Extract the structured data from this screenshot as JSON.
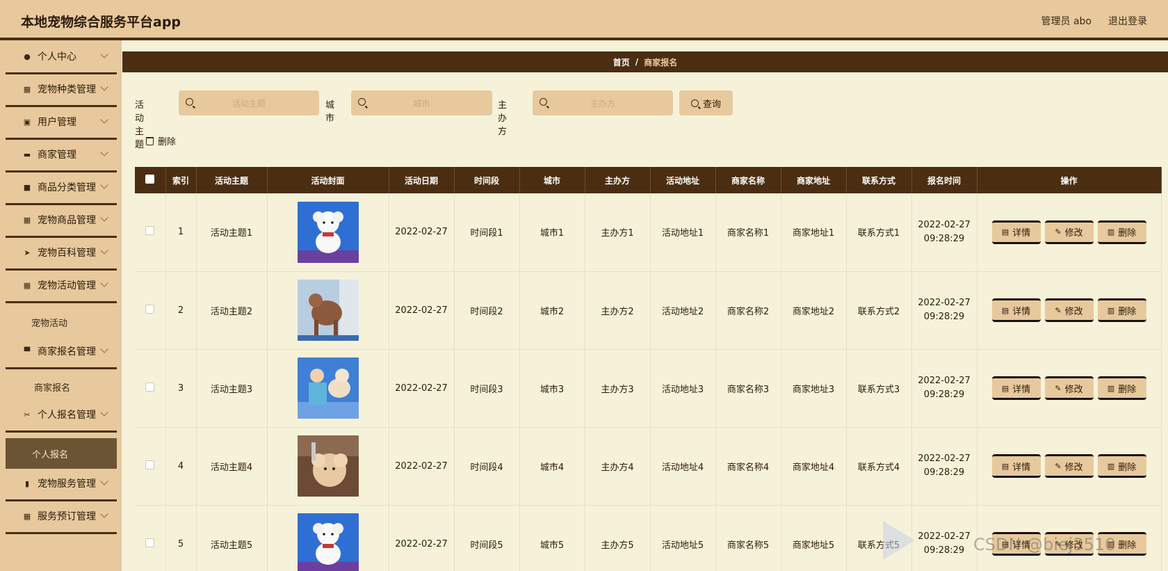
{
  "header": {
    "title": "本地宠物综合服务平台app",
    "user": "管理员 abo",
    "logout": "退出登录"
  },
  "sidebar": {
    "items": [
      {
        "label": "个人中心",
        "icon": "person-icon"
      },
      {
        "label": "宠物种类管理",
        "icon": "grid-icon"
      },
      {
        "label": "用户管理",
        "icon": "clipboard-icon"
      },
      {
        "label": "商家管理",
        "icon": "chat-icon"
      },
      {
        "label": "商品分类管理",
        "icon": "briefcase-icon"
      },
      {
        "label": "宠物商品管理",
        "icon": "grid-icon"
      },
      {
        "label": "宠物百科管理",
        "icon": "send-icon"
      },
      {
        "label": "宠物活动管理",
        "icon": "grid-icon"
      },
      {
        "label": "商家报名管理",
        "icon": "printer-icon"
      },
      {
        "label": "个人报名管理",
        "icon": "ticket-icon"
      },
      {
        "label": "宠物服务管理",
        "icon": "bars-icon"
      },
      {
        "label": "服务预订管理",
        "icon": "grid-icon"
      }
    ],
    "subs": {
      "pet_activity": "宠物活动",
      "merchant_signup": "商家报名",
      "personal_signup": "个人报名"
    }
  },
  "breadcrumb": {
    "home": "首页",
    "sep": "/",
    "current": "商家报名"
  },
  "search": {
    "topic_label": "活动主题",
    "topic_placeholder": "活动主题",
    "city_label": "城市",
    "city_placeholder": "城市",
    "organizer_label": "主办方",
    "organizer_placeholder": "主办方",
    "button": "查询"
  },
  "toolbar": {
    "delete": "删除"
  },
  "table": {
    "headers": [
      "索引",
      "活动主题",
      "活动封面",
      "活动日期",
      "时间段",
      "城市",
      "主办方",
      "活动地址",
      "商家名称",
      "商家地址",
      "联系方式",
      "报名时间",
      "操作"
    ],
    "rows": [
      {
        "index": "1",
        "topic": "活动主题1",
        "date": "2022-02-27",
        "slot": "时间段1",
        "city": "城市1",
        "organizer": "主办方1",
        "address": "活动地址1",
        "merchant": "商家名称1",
        "maddr": "商家地址1",
        "contact": "联系方式1",
        "time_date": "2022-02-27",
        "time_clock": "09:28:29"
      },
      {
        "index": "2",
        "topic": "活动主题2",
        "date": "2022-02-27",
        "slot": "时间段2",
        "city": "城市2",
        "organizer": "主办方2",
        "address": "活动地址2",
        "merchant": "商家名称2",
        "maddr": "商家地址2",
        "contact": "联系方式2",
        "time_date": "2022-02-27",
        "time_clock": "09:28:29"
      },
      {
        "index": "3",
        "topic": "活动主题3",
        "date": "2022-02-27",
        "slot": "时间段3",
        "city": "城市3",
        "organizer": "主办方3",
        "address": "活动地址3",
        "merchant": "商家名称3",
        "maddr": "商家地址3",
        "contact": "联系方式3",
        "time_date": "2022-02-27",
        "time_clock": "09:28:29"
      },
      {
        "index": "4",
        "topic": "活动主题4",
        "date": "2022-02-27",
        "slot": "时间段4",
        "city": "城市4",
        "organizer": "主办方4",
        "address": "活动地址4",
        "merchant": "商家名称4",
        "maddr": "商家地址4",
        "contact": "联系方式4",
        "time_date": "2022-02-27",
        "time_clock": "09:28:29"
      },
      {
        "index": "5",
        "topic": "活动主题5",
        "date": "2022-02-27",
        "slot": "时间段5",
        "city": "城市5",
        "organizer": "主办方5",
        "address": "活动地址5",
        "merchant": "商家名称5",
        "maddr": "商家地址5",
        "contact": "联系方式5",
        "time_date": "2022-02-27",
        "time_clock": "09:28:29"
      }
    ],
    "actions": {
      "detail": "详情",
      "edit": "修改",
      "delete": "删除"
    }
  },
  "watermark": {
    "text": "CSDN @biej3510"
  },
  "colors": {
    "accent": "#e7c99d",
    "dark": "#4b2e12",
    "background": "#f6f2da"
  }
}
